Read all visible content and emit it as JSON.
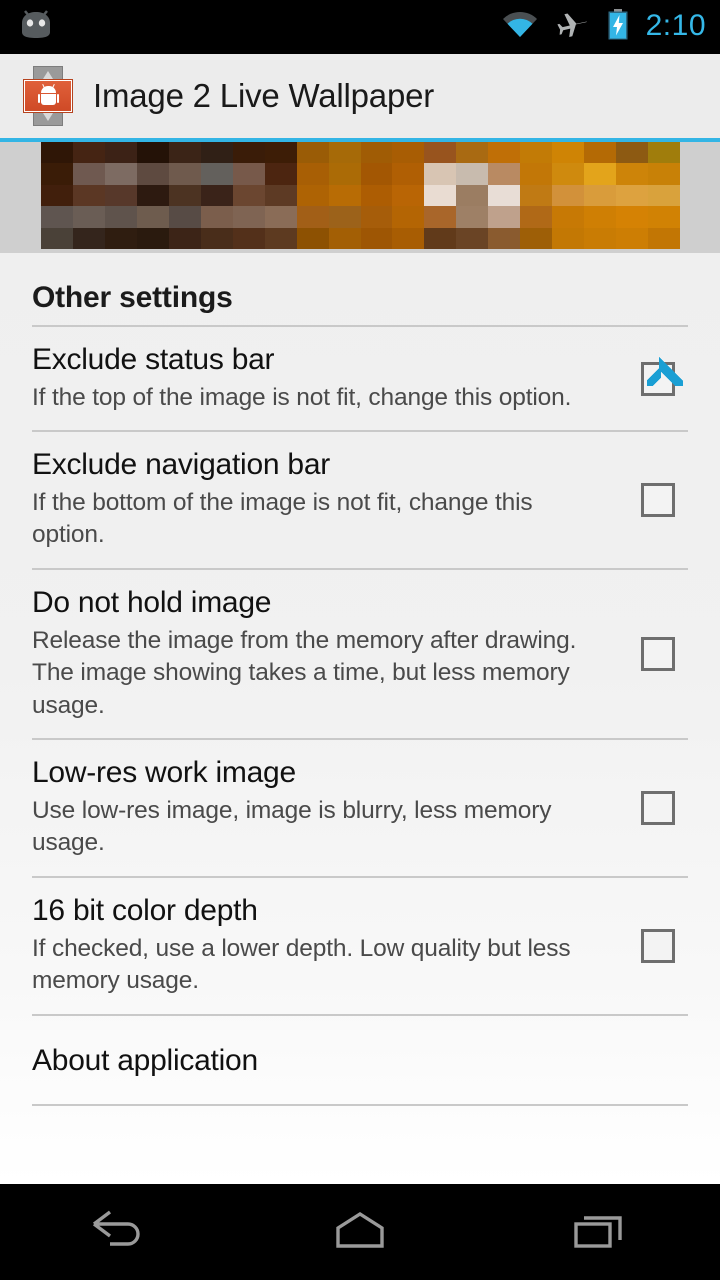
{
  "status_bar": {
    "notification_icon": "android-head-icon",
    "icons": [
      "wifi-icon",
      "airplane-mode-icon",
      "battery-charging-icon"
    ],
    "clock": "2:10",
    "clock_color": "#35b8e8"
  },
  "action_bar": {
    "app_icon": "image-2-live-wallpaper-icon",
    "title": "Image 2 Live Wallpaper",
    "accent_color": "#33b5e5"
  },
  "preview": {
    "name": "wallpaper-preview-thumbnail",
    "backdrop_color": "#cfcfcf",
    "pixels": [
      "#2f1606",
      "#452413",
      "#3c2216",
      "#241207",
      "#3b2417",
      "#302016",
      "#3a1c08",
      "#3d1d06",
      "#9a5c06",
      "#a66a08",
      "#a05c05",
      "#a85d04",
      "#98541e",
      "#a96a12",
      "#c06f06",
      "#c27b06",
      "#cf8405",
      "#b46a05",
      "#8d5a12",
      "#a07d0c",
      "#3a1c07",
      "#6f5950",
      "#7d6b62",
      "#5e4a40",
      "#6f5a4d",
      "#63605c",
      "#77594a",
      "#4c2510",
      "#a85f05",
      "#ab6b06",
      "#a35703",
      "#b05f04",
      "#d8c5b3",
      "#c8bbae",
      "#b98a62",
      "#c27707",
      "#cf8a0e",
      "#e3a41b",
      "#cd8409",
      "#c88107",
      "#411f0c",
      "#5b3724",
      "#57382a",
      "#2d1a10",
      "#4c3322",
      "#3a2319",
      "#6b4630",
      "#5d3a24",
      "#ae6304",
      "#b86c05",
      "#ad5d03",
      "#b96505",
      "#e9dcd2",
      "#9b7d62",
      "#e8ddd6",
      "#c07a14",
      "#d2913a",
      "#d99c3b",
      "#dda23f",
      "#d9a23c",
      "#5f5550",
      "#6a5d55",
      "#5f534c",
      "#6e5c4e",
      "#574b45",
      "#7b5e4c",
      "#7f6453",
      "#8a6c57",
      "#a25f17",
      "#9c621a",
      "#a65d0a",
      "#b46504",
      "#a9662a",
      "#9e8066",
      "#bfa18c",
      "#b06917",
      "#c77905",
      "#cf7f04",
      "#d58204",
      "#d18204",
      "#4a4138",
      "#34251c",
      "#2f1d10",
      "#2a1a0e",
      "#3c2417",
      "#492d1a",
      "#53301a",
      "#5d3a20",
      "#8d5102",
      "#a35f05",
      "#9e5604",
      "#a85d03",
      "#613a1a",
      "#6a4425",
      "#8a5b2f",
      "#9e5f07",
      "#c37804",
      "#c97c04",
      "#cd7e04",
      "#c27604"
    ]
  },
  "main": {
    "section_title": "Other settings",
    "preferences": [
      {
        "title": "Exclude status bar",
        "summary": "If the top of the image is not fit, change this option.",
        "checked": true,
        "name": "exclude-status-bar"
      },
      {
        "title": "Exclude navigation bar",
        "summary": "If the bottom of the image is not fit, change this option.",
        "checked": false,
        "name": "exclude-navigation-bar"
      },
      {
        "title": "Do not hold image",
        "summary": "Release the image from the memory after drawing. The image showing takes a time, but less memory usage.",
        "checked": false,
        "name": "do-not-hold-image"
      },
      {
        "title": "Low-res work image",
        "summary": "Use low-res image, image is blurry, less memory usage.",
        "checked": false,
        "name": "low-res-work-image"
      },
      {
        "title": "16 bit color depth",
        "summary": "If checked, use a lower depth. Low quality but less memory usage.",
        "checked": false,
        "name": "16-bit-color-depth"
      }
    ],
    "about_item": "About application"
  },
  "nav_bar": {
    "back": "back-icon",
    "home": "home-icon",
    "recents": "recents-icon"
  }
}
